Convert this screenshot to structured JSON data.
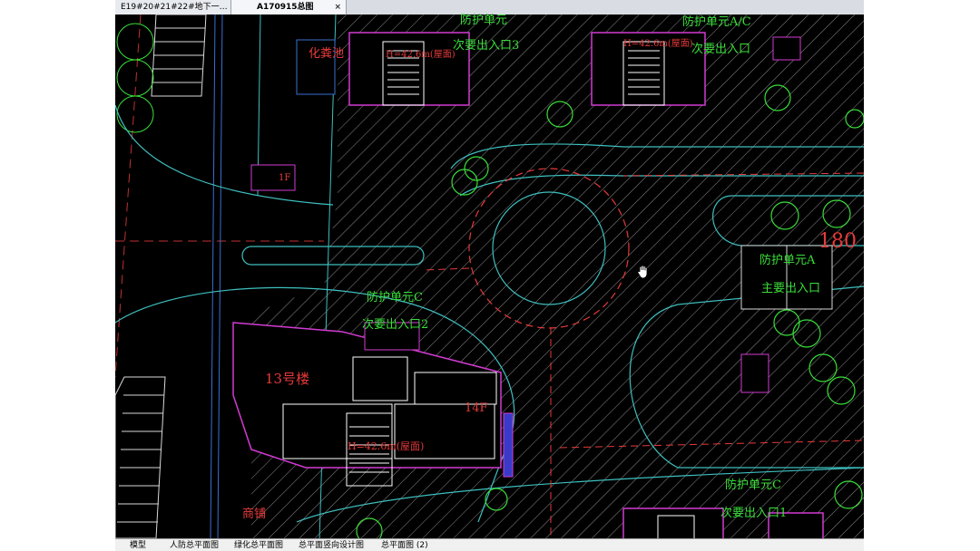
{
  "doc_tabs": [
    {
      "label": "E19#20#21#22#地下一…",
      "active": false
    },
    {
      "label": "A170915总图",
      "active": true
    }
  ],
  "close_glyph": "×",
  "labels": {
    "septic_tank": "化粪池",
    "protect_unit_top": "防护单元",
    "secondary_exit_3": "次要出入口3",
    "protect_unit_a_top": "防护单元A/C",
    "secondary_exit_top_right": "次要出入口",
    "floor_1f": "1F",
    "protect_unit_a": "防护单元A",
    "main_exit": "主要出入口",
    "protect_unit_c": "防护单元C",
    "secondary_exit_2": "次要出入口2",
    "building_13": "13号楼",
    "floors_14f": "14F",
    "height_mark": "H=42.6m(屋面)",
    "shops": "商铺",
    "protect_unit_c_bottom": "防护单元C",
    "secondary_exit_1": "次要出入口1",
    "height_mark_top": "H=42.6m(屋面)",
    "height_mark_top_right": "H=42.6m(屋面)",
    "number_180": "180"
  },
  "layout_tabs": [
    {
      "label": "模型"
    },
    {
      "label": "人防总平面图"
    },
    {
      "label": "绿化总平面图"
    },
    {
      "label": "总平面竖向设计图"
    },
    {
      "label": "总平面图 (2)"
    }
  ],
  "colors": {
    "green_text": "#3adf3a",
    "red_text": "#e83a3a",
    "magenta": "#d23bd2",
    "cyan": "#3fbfbf",
    "hatch": "#8a8a8a"
  },
  "icons": {
    "pan_cursor": "hand-pan-icon"
  }
}
